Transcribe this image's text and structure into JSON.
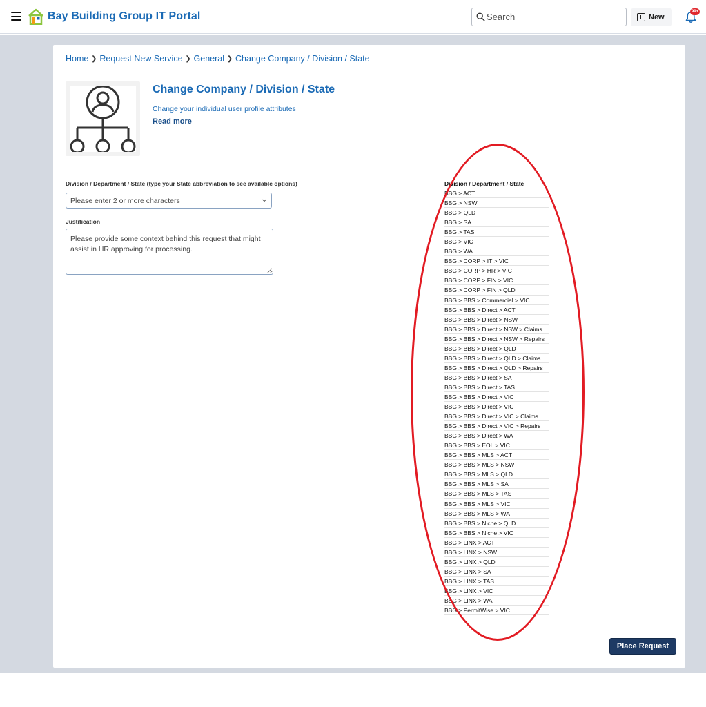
{
  "header": {
    "app_title": "Bay Building Group IT Portal",
    "search_placeholder": "Search",
    "new_label": "New",
    "notification_badge": "99+",
    "brand_color": "#1a6ab5"
  },
  "breadcrumb": [
    "Home",
    "Request New Service",
    "General",
    "Change Company / Division / State"
  ],
  "service": {
    "title": "Change Company / Division / State",
    "description": "Change your individual user profile attributes",
    "read_more": "Read more",
    "icon": "org-chart-user-icon"
  },
  "form": {
    "division_label": "Division / Department / State (type your State abbreviation to see available options)",
    "division_placeholder": "Please enter 2 or more characters",
    "justification_label": "Justification",
    "justification_placeholder": "Please provide some context behind this request that might assist in HR approving for processing."
  },
  "options_list": {
    "header": "Division / Department / State",
    "items": [
      "BBG > ACT",
      "BBG > NSW",
      "BBG > QLD",
      "BBG > SA",
      "BBG > TAS",
      "BBG > VIC",
      "BBG > WA",
      "BBG > CORP > IT > VIC",
      "BBG > CORP > HR > VIC",
      "BBG > CORP > FIN > VIC",
      "BBG > CORP > FIN > QLD",
      "BBG > BBS > Commercial > VIC",
      "BBG > BBS > Direct > ACT",
      "BBG > BBS > Direct > NSW",
      "BBG > BBS > Direct > NSW > Claims",
      "BBG > BBS > Direct > NSW > Repairs",
      "BBG > BBS > Direct > QLD",
      "BBG > BBS > Direct > QLD > Claims",
      "BBG > BBS > Direct > QLD > Repairs",
      "BBG > BBS > Direct > SA",
      "BBG > BBS > Direct > TAS",
      "BBG > BBS > Direct > VIC",
      "BBG > BBS > Direct > VIC",
      "BBG > BBS > Direct > VIC > Claims",
      "BBG > BBS > Direct > VIC > Repairs",
      "BBG > BBS > Direct > WA",
      "BBG > BBS > EOL > VIC",
      "BBG > BBS > MLS > ACT",
      "BBG > BBS > MLS > NSW",
      "BBG > BBS > MLS > QLD",
      "BBG > BBS > MLS > SA",
      "BBG > BBS > MLS > TAS",
      "BBG > BBS > MLS > VIC",
      "BBG > BBS > MLS > WA",
      "BBG > BBS > Niche > QLD",
      "BBG > BBS > Niche > VIC",
      "BBG > LINX > ACT",
      "BBG > LINX > NSW",
      "BBG > LINX > QLD",
      "BBG > LINX > SA",
      "BBG > LINX > TAS",
      "BBG > LINX > VIC",
      "BBG > LINX > WA",
      "BBG > PermitWise > VIC"
    ]
  },
  "annotation_color": "#e21b23",
  "footer": {
    "place_request": "Place Request"
  }
}
